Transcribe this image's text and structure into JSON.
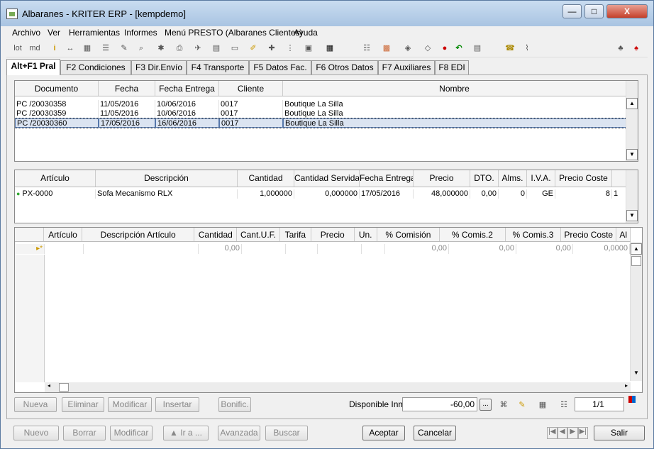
{
  "window": {
    "title": "Albaranes - KRITER ERP -  [kempdemo]",
    "min": "—",
    "max": "□",
    "close": "X"
  },
  "menu": [
    "Archivo",
    "Ver",
    "Herramientas",
    "Informes",
    "Menú PRESTO (Albaranes Clientes)",
    "Ayuda"
  ],
  "toolbar_text": {
    "lot": "lot",
    "md": "md"
  },
  "tabs": [
    "Alt+F1 Pral",
    "F2 Condiciones",
    "F3 Dir.Envío",
    "F4 Transporte",
    "F5 Datos Fac.",
    "F6 Otros Datos",
    "F7 Auxiliares",
    "F8 EDI"
  ],
  "albaranes": {
    "columns": [
      "Documento",
      "Fecha",
      "Fecha Entrega",
      "Cliente",
      "Nombre"
    ],
    "rows": [
      [
        "PC /20030358",
        "11/05/2016",
        "10/06/2016",
        "0017",
        "Boutique La Silla"
      ],
      [
        "PC /20030359",
        "11/05/2016",
        "10/06/2016",
        "0017",
        "Boutique La Silla"
      ],
      [
        "PC /20030360",
        "17/05/2016",
        "16/06/2016",
        "0017",
        "Boutique La Silla"
      ]
    ]
  },
  "lineas": {
    "columns": [
      "Artículo",
      "Descripción",
      "Cantidad",
      "Cantidad Servida",
      "Fecha Entrega",
      "Precio",
      "DTO.",
      "Alms.",
      "I.V.A.",
      "Precio Coste",
      ""
    ],
    "rows": [
      [
        "PX-0000",
        "Sofa Mecanismo RLX",
        "1,000000",
        "0,000000",
        "17/05/2016",
        "48,000000",
        "0,00",
        "0",
        "GE",
        "8",
        "1"
      ]
    ]
  },
  "componentes": {
    "columns": [
      "Artículo",
      "Descripción Artículo",
      "Cantidad",
      "Cant.U.F.",
      "Tarifa",
      "Precio",
      "Un.",
      "% Comisión",
      "% Comis.2",
      "% Comis.3",
      "Precio Coste",
      "Al"
    ],
    "new_row": [
      "",
      "",
      "0,00",
      "",
      "",
      "",
      "",
      "0,00",
      "0,00",
      "0,00",
      "0,0000",
      ""
    ]
  },
  "sub_buttons": {
    "nueva": "Nueva",
    "eliminar": "Eliminar",
    "modificar": "Modificar",
    "insertar": "Insertar",
    "bonific": "Bonific."
  },
  "disponible": {
    "label": "Disponible Inm",
    "value": "-60,00",
    "ellipsis": "..."
  },
  "pager": "1/1",
  "bottom": {
    "nuevo": "Nuevo",
    "borrar": "Borrar",
    "modificar": "Modificar",
    "ira": "▲ Ir a ...",
    "avanzada": "Avanzada",
    "buscar": "Buscar",
    "aceptar": "Aceptar",
    "cancelar": "Cancelar",
    "salir": "Salir"
  }
}
